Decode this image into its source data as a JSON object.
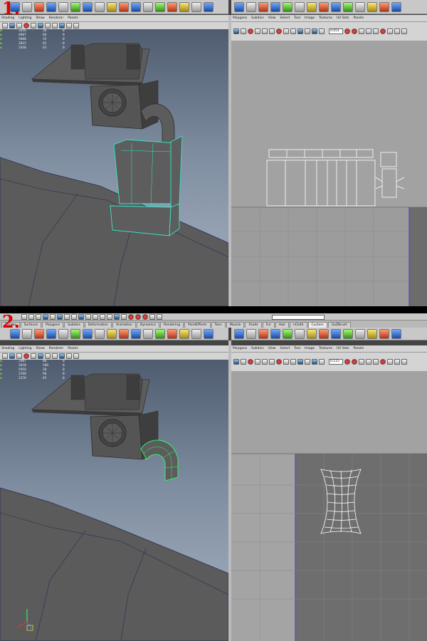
{
  "steps": [
    "1.",
    "2."
  ],
  "shelf_tabs": [
    "Curves",
    "Surfaces",
    "Polygons",
    "Subdivs",
    "Deformation",
    "Animation",
    "Dynamics",
    "Rendering",
    "PaintEffects",
    "Toon",
    "Muscle",
    "Fluids",
    "Fur",
    "Hair",
    "nCloth",
    "Custom",
    "GoZBrush"
  ],
  "shelf_active": "Custom",
  "viewport_menu": [
    "Shading",
    "Lighting",
    "Show",
    "Renderer",
    "Panels"
  ],
  "uv_menu": [
    "Polygons",
    "Subdivs",
    "View",
    "Select",
    "Tool",
    "Image",
    "Textures",
    "UV Sets",
    "Panels"
  ],
  "panel1": {
    "hud": [
      [
        "2838",
        "36",
        "0"
      ],
      [
        "4887",
        "66",
        "0"
      ],
      [
        "5080",
        "35",
        "0"
      ],
      [
        "3822",
        "62",
        "0"
      ],
      [
        "2440",
        "63",
        "0"
      ]
    ],
    "uv_value": "0.051"
  },
  "panel2": {
    "hud": [
      [
        "2907",
        "88",
        "0"
      ],
      [
        "3830",
        "586",
        "0"
      ],
      [
        "5958",
        "30",
        "0"
      ],
      [
        "3788",
        "96",
        "0"
      ],
      [
        "2378",
        "65",
        "0"
      ]
    ],
    "uv_value": "0.115"
  },
  "icons": {
    "shelf": "shelf-tool-icon",
    "axis": "axis-gizmo-icon"
  },
  "colors": {
    "step_number": "#e00000",
    "selection": "#35e8c8",
    "green_select": "#2dff6a",
    "uv_border": "#4a4ad0"
  }
}
